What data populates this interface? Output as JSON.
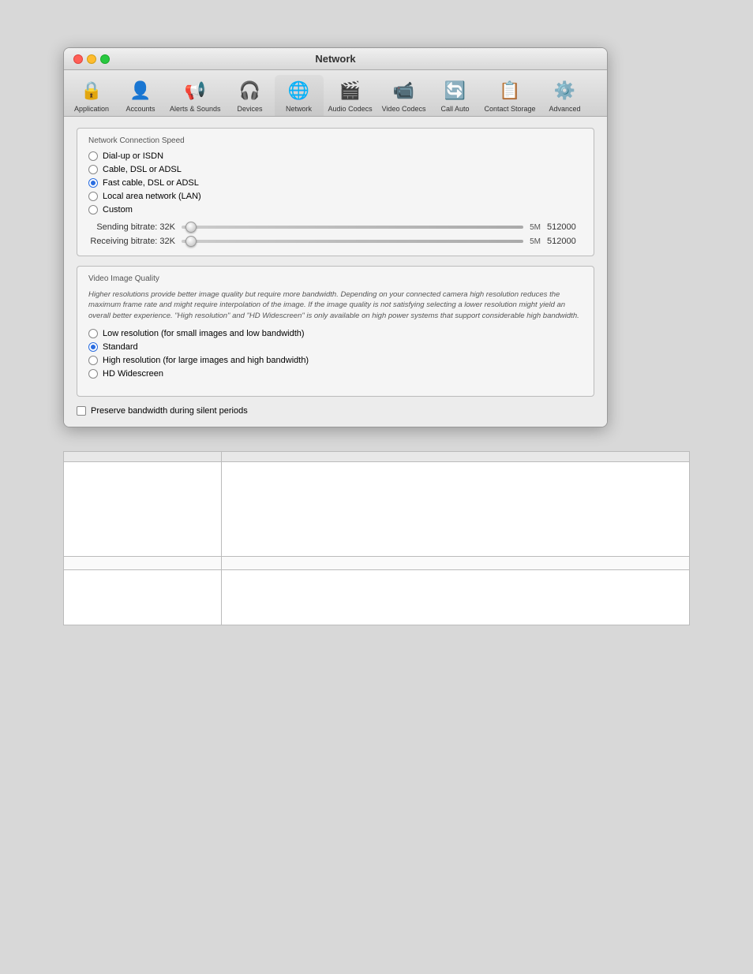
{
  "window": {
    "title": "Network",
    "traffic_lights": [
      "close",
      "minimize",
      "maximize"
    ]
  },
  "toolbar": {
    "items": [
      {
        "id": "application",
        "label": "Application",
        "icon": "🔒"
      },
      {
        "id": "accounts",
        "label": "Accounts",
        "icon": "👤"
      },
      {
        "id": "alerts-sounds",
        "label": "Alerts & Sounds",
        "icon": "📢"
      },
      {
        "id": "devices",
        "label": "Devices",
        "icon": "🎧"
      },
      {
        "id": "network",
        "label": "Network",
        "icon": "🌐"
      },
      {
        "id": "audio-codecs",
        "label": "Audio Codecs",
        "icon": "🎬"
      },
      {
        "id": "video-codecs",
        "label": "Video Codecs",
        "icon": "📹"
      },
      {
        "id": "call-auto",
        "label": "Call Auto",
        "icon": "🔄"
      },
      {
        "id": "contact-storage",
        "label": "Contact Storage",
        "icon": "📋"
      },
      {
        "id": "advanced",
        "label": "Advanced",
        "icon": "⚙️"
      }
    ],
    "active": "network"
  },
  "network_connection_speed": {
    "section_title": "Network Connection Speed",
    "options": [
      {
        "label": "Dial-up or ISDN",
        "selected": false
      },
      {
        "label": "Cable, DSL or ADSL",
        "selected": false
      },
      {
        "label": "Fast cable, DSL or ADSL",
        "selected": true
      },
      {
        "label": "Local area network (LAN)",
        "selected": false
      },
      {
        "label": "Custom",
        "selected": false
      }
    ],
    "sending": {
      "label": "Sending bitrate: 32K",
      "min": "32K",
      "max": "5M",
      "value": "512000"
    },
    "receiving": {
      "label": "Receiving bitrate: 32K",
      "min": "32K",
      "max": "5M",
      "value": "512000"
    }
  },
  "video_image_quality": {
    "section_title": "Video Image Quality",
    "info_text": "Higher resolutions provide better image quality but require more bandwidth. Depending on your connected camera high resolution reduces the maximum frame rate and might require interpolation of the image. If the image quality is not satisfying selecting a lower resolution might yield an overall better experience.\n\"High resolution\" and \"HD Widescreen\" is only available on high power systems that support considerable high bandwidth.",
    "options": [
      {
        "label": "Low resolution (for small images and low bandwidth)",
        "selected": false
      },
      {
        "label": "Standard",
        "selected": true
      },
      {
        "label": "High resolution (for large images and high bandwidth)",
        "selected": false
      },
      {
        "label": "HD Widescreen",
        "selected": false
      }
    ]
  },
  "preserve_bandwidth": {
    "label": "Preserve bandwidth during silent periods",
    "checked": false
  },
  "table": {
    "headers": [
      "",
      ""
    ],
    "rows": [
      {
        "col1": "",
        "col2": "",
        "height": "tall"
      },
      {
        "col1": "",
        "col2": "",
        "height": "short"
      },
      {
        "col1": "",
        "col2": "",
        "height": "medium"
      }
    ]
  }
}
